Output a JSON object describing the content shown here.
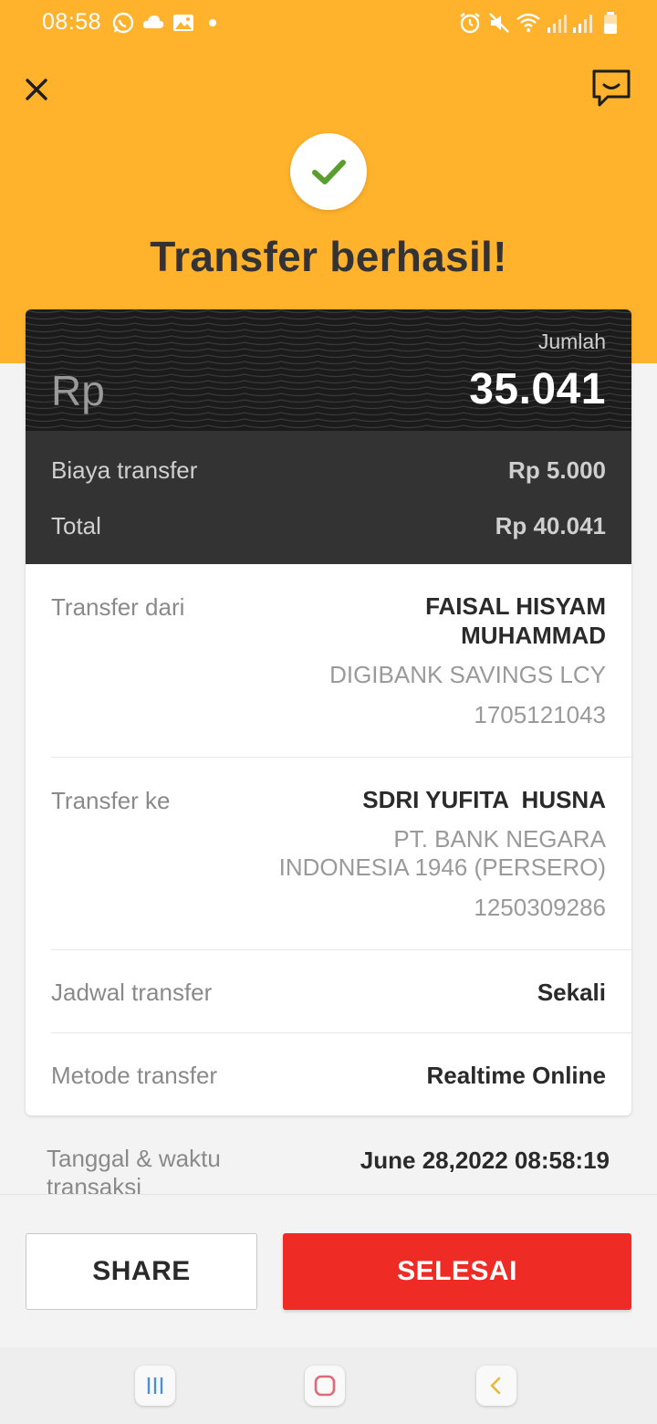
{
  "status_bar": {
    "time": "08:58",
    "left_icons": [
      "whatsapp-icon",
      "cloud-icon",
      "gallery-icon"
    ],
    "right_icons": [
      "alarm-icon",
      "mute-icon",
      "wifi-icon",
      "signal-icon",
      "signal-icon",
      "battery-icon"
    ]
  },
  "header": {
    "close_icon": "close-icon",
    "chat_icon": "chat-icon",
    "success_icon": "check-icon",
    "title": "Transfer berhasil!"
  },
  "amount": {
    "label": "Jumlah",
    "currency": "Rp",
    "value": "35.041"
  },
  "fees": {
    "fee_label": "Biaya transfer",
    "fee_value": "Rp 5.000",
    "total_label": "Total",
    "total_value": "Rp 40.041"
  },
  "from": {
    "label": "Transfer dari",
    "name_line1": "FAISAL HISYAM",
    "name_line2": "MUHAMMAD",
    "account_type": "DIGIBANK SAVINGS LCY",
    "account_number": "1705121043"
  },
  "to": {
    "label": "Transfer ke",
    "name": "SDRI YUFITA  HUSNA",
    "bank_line1": "PT. BANK NEGARA",
    "bank_line2": "INDONESIA 1946 (PERSERO)",
    "account_number": "1250309286"
  },
  "schedule": {
    "label": "Jadwal transfer",
    "value": "Sekali"
  },
  "method": {
    "label": "Metode transfer",
    "value": "Realtime Online"
  },
  "transaction": {
    "label": "Tanggal & waktu transaksi",
    "value": "June 28,2022 08:58:19"
  },
  "actions": {
    "share_label": "SHARE",
    "done_label": "SELESAI"
  },
  "colors": {
    "header_bg": "#ffb22c",
    "primary_button": "#ee2b24",
    "check": "#5a9e2f"
  }
}
